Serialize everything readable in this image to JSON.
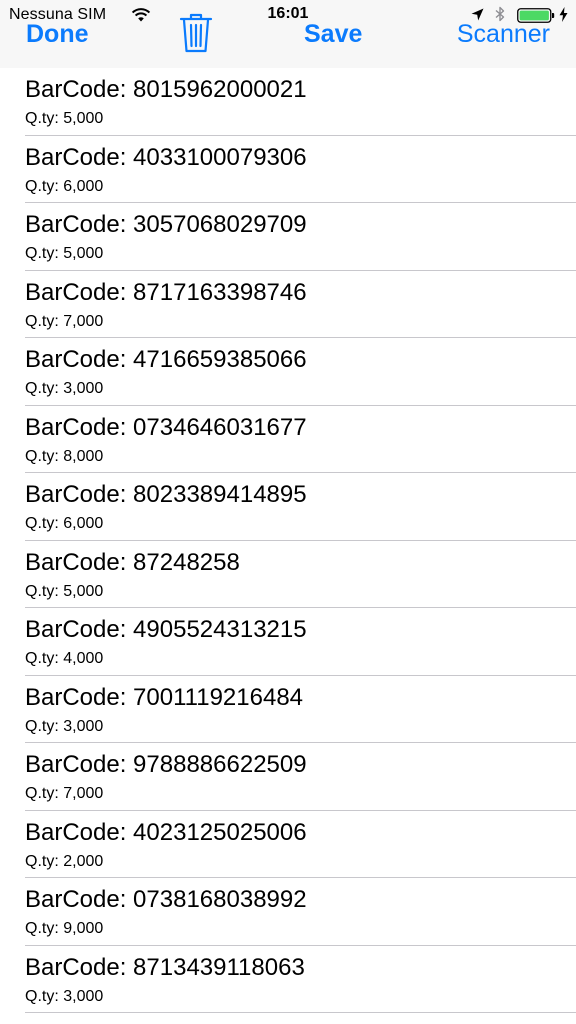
{
  "status_bar": {
    "carrier": "Nessuna SIM",
    "time": "16:01",
    "icons": [
      "wifi-icon",
      "location-icon",
      "bluetooth-icon",
      "battery-icon",
      "charging-icon"
    ]
  },
  "nav": {
    "done_label": "Done",
    "save_label": "Save",
    "scanner_label": "Scanner",
    "trash_icon": "trash-icon",
    "accent_color": "#0b7bfd"
  },
  "items": [
    {
      "title": "BarCode: 8015962000021",
      "qty": "Q.ty: 5,000"
    },
    {
      "title": "BarCode: 4033100079306",
      "qty": "Q.ty: 6,000"
    },
    {
      "title": "BarCode: 3057068029709",
      "qty": "Q.ty: 5,000"
    },
    {
      "title": "BarCode: 8717163398746",
      "qty": "Q.ty: 7,000"
    },
    {
      "title": "BarCode: 4716659385066",
      "qty": "Q.ty: 3,000"
    },
    {
      "title": "BarCode: 0734646031677",
      "qty": "Q.ty: 8,000"
    },
    {
      "title": "BarCode: 8023389414895",
      "qty": "Q.ty: 6,000"
    },
    {
      "title": "BarCode: 87248258",
      "qty": "Q.ty: 5,000"
    },
    {
      "title": "BarCode: 4905524313215",
      "qty": "Q.ty: 4,000"
    },
    {
      "title": "BarCode: 7001119216484",
      "qty": "Q.ty: 3,000"
    },
    {
      "title": "BarCode: 9788886622509",
      "qty": "Q.ty: 7,000"
    },
    {
      "title": "BarCode: 4023125025006",
      "qty": "Q.ty: 2,000"
    },
    {
      "title": "BarCode: 0738168038992",
      "qty": "Q.ty: 9,000"
    },
    {
      "title": "BarCode: 8713439118063",
      "qty": "Q.ty: 3,000"
    }
  ]
}
